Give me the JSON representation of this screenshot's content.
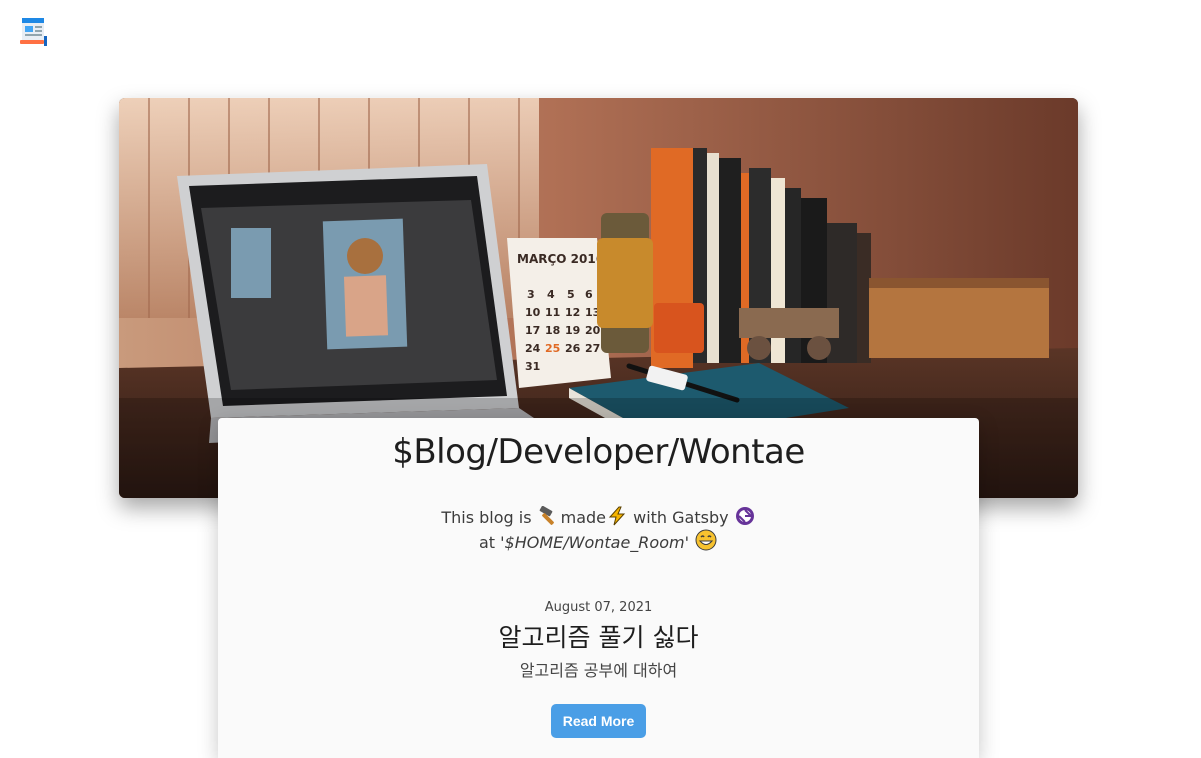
{
  "header": {
    "logo_icon": "blog-page-icon"
  },
  "hero": {
    "image_description_icon": "desk-laptop-photo",
    "calendar_month": "MARÇO 2016",
    "calendar_rows": [
      [
        "3",
        "4",
        "5",
        "6"
      ],
      [
        "10",
        "11",
        "12",
        "13"
      ],
      [
        "17",
        "18",
        "19",
        "20"
      ],
      [
        "24",
        "25",
        "26",
        "27"
      ],
      [
        "31"
      ]
    ]
  },
  "blog": {
    "title": "$Blog/Developer/Wontae",
    "desc_this_blog_is": "This blog is",
    "desc_made": "made",
    "desc_with_gatsby": "with Gatsby",
    "desc_at": "at",
    "desc_home_path": "'$HOME/Wontae_Room'",
    "emoji_hammer": "hammer-icon",
    "emoji_lightning": "lightning-icon",
    "emoji_gatsby": "gatsby-logo-icon",
    "emoji_smile": "smile-icon"
  },
  "post": {
    "date": "August 07, 2021",
    "title": "알고리즘 풀기 싫다",
    "summary": "알고리즘 공부에 대하여",
    "read_more_label": "Read More"
  },
  "colors": {
    "button": "#4a9ee6",
    "card": "#fafafa",
    "title_text": "#1e1e1e"
  }
}
